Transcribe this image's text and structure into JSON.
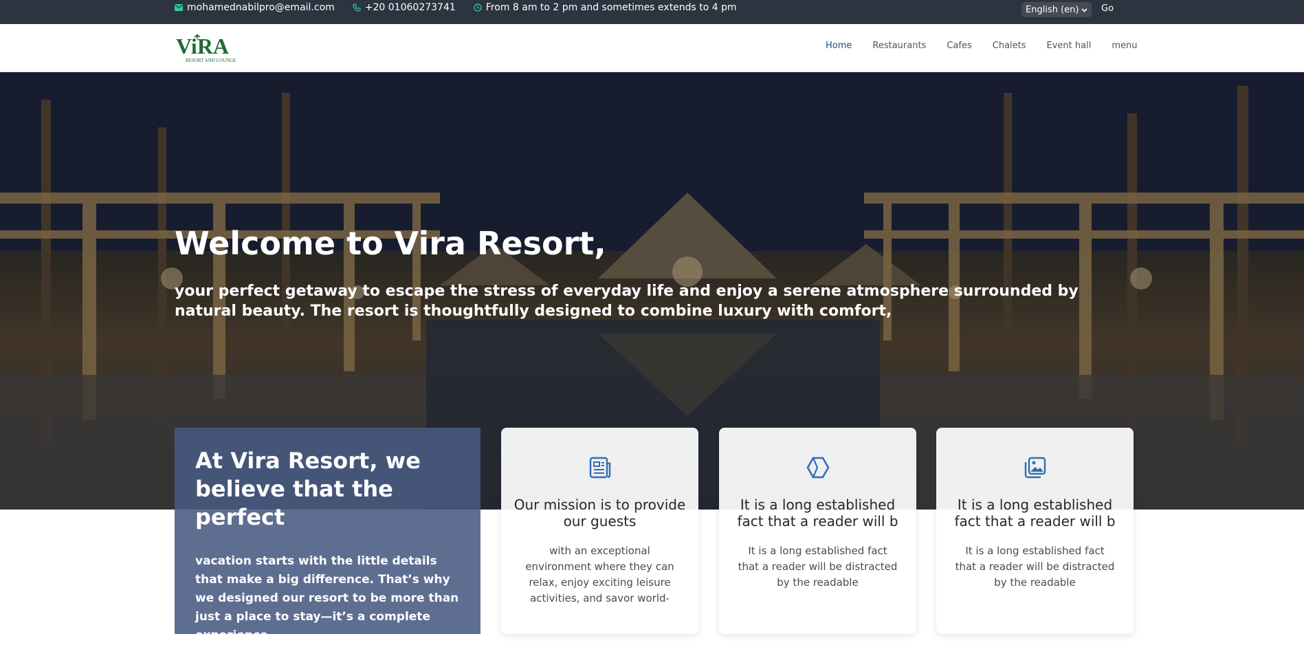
{
  "topbar": {
    "email": "mohamednabilpro@email.com",
    "email_icon": "envelope-icon",
    "phone": "+20 01060273741",
    "phone_icon": "phone-icon",
    "hours": "From 8 am to 2 pm and sometimes extends to 4 pm",
    "hours_icon": "clock-icon",
    "language_selected": "English (en)",
    "go_label": "Go"
  },
  "navbar": {
    "logo_text": "ViRA",
    "logo_tagline": "RESORT AND LOUNGE",
    "links": [
      {
        "label": "Home",
        "active": true
      },
      {
        "label": "Restaurants",
        "active": false
      },
      {
        "label": "Cafes",
        "active": false
      },
      {
        "label": "Chalets",
        "active": false
      },
      {
        "label": "Event hall",
        "active": false
      },
      {
        "label": "menu",
        "active": false
      }
    ]
  },
  "hero": {
    "title": "Welcome to Vira Resort,",
    "subtitle": "your perfect getaway to escape the stress of everyday life and enjoy a serene atmosphere surrounded by natural beauty. The resort is thoughtfully designed to combine luxury with comfort,"
  },
  "intro": {
    "heading": "At Vira Resort, we believe that the perfect",
    "body": "vacation starts with the little details that make a big difference. That’s why we designed our resort to be more than just a place to stay—it’s a complete experience"
  },
  "cards": [
    {
      "icon": "document-icon",
      "title": "Our mission is to provide our guests",
      "body": "with an exceptional environment where they can relax, enjoy exciting leisure activities, and savor world-"
    },
    {
      "icon": "hexagon-icon",
      "title": "It is a long established fact that a reader will b",
      "body": "It is a long established fact that a reader will be distracted by the readable"
    },
    {
      "icon": "images-icon",
      "title": "It is a long established fact that a reader will b",
      "body": "It is a long established fact that a reader will be distracted by the readable"
    }
  ],
  "colors": {
    "topbar_bg": "#2c3440",
    "icon_accent": "#2ecc9a",
    "nav_active": "#1e4f7a",
    "card_icon": "#2f6db3",
    "intro_card_bg": "#485a82",
    "logo_green": "#1d6b34"
  }
}
